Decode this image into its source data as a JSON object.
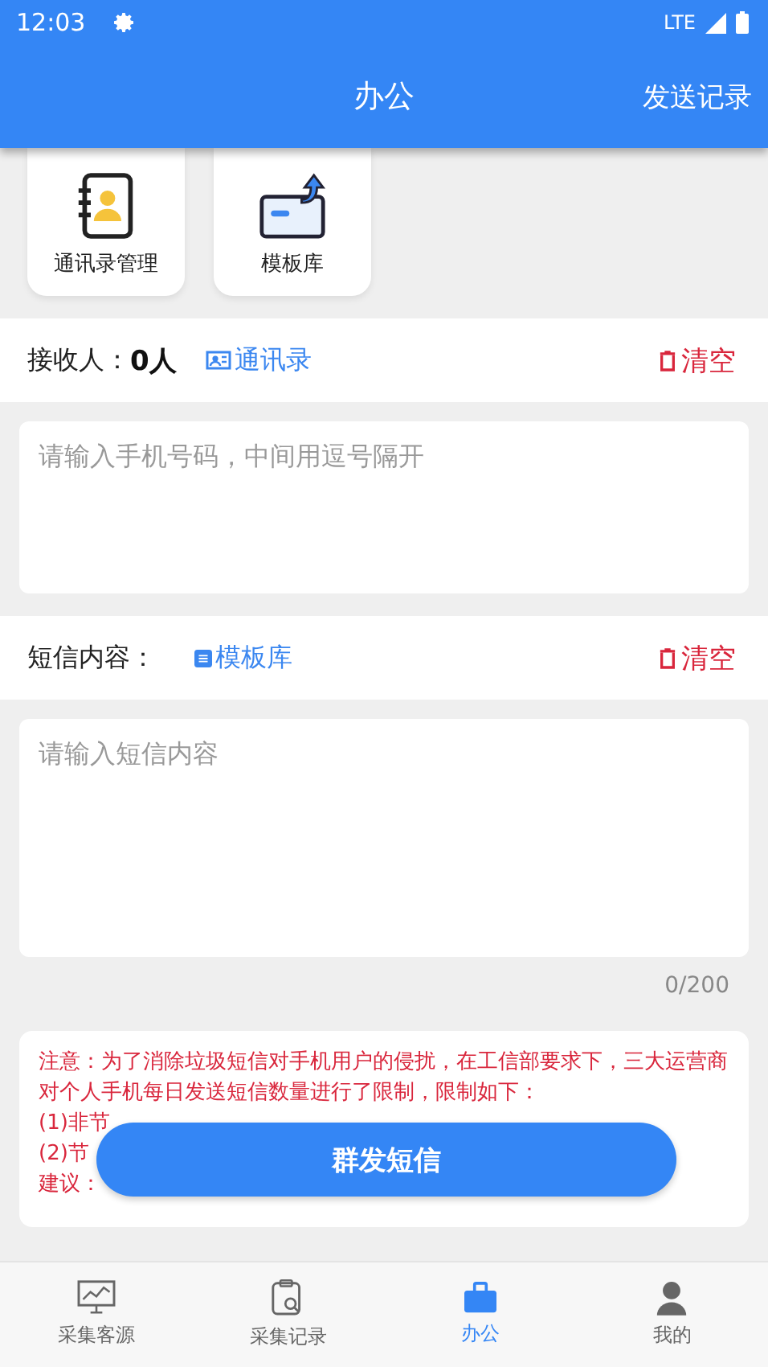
{
  "status_bar": {
    "time": "12:03",
    "network": "LTE"
  },
  "app_bar": {
    "title": "办公",
    "action": "发送记录"
  },
  "shortcuts": [
    {
      "kind": "contacts",
      "label": "通讯录管理"
    },
    {
      "kind": "template",
      "label": "模板库"
    }
  ],
  "recipients": {
    "label": "接收人：",
    "count": "0人",
    "link": "通讯录",
    "clear": "清空"
  },
  "phone_field": {
    "placeholder": "请输入手机号码，中间用逗号隔开"
  },
  "content": {
    "label": "短信内容：",
    "link": "模板库",
    "clear": "清空"
  },
  "message_field": {
    "placeholder": "请输入短信内容"
  },
  "counter": "0/200",
  "notice": [
    "注意：为了消除垃圾短信对手机用户的侵扰，在工信部要求下，三大运营商对个人手机每日发送短信数量进行了限制，限制如下：",
    "(1)非节",
    "(2)节",
    "建议："
  ],
  "send_button": "群发短信",
  "bottom_nav": [
    {
      "kind": "monitor",
      "label": "采集客源",
      "selected": false
    },
    {
      "kind": "clipboard",
      "label": "采集记录",
      "selected": false
    },
    {
      "kind": "office",
      "label": "办公",
      "selected": true
    },
    {
      "kind": "person",
      "label": "我的",
      "selected": false
    }
  ]
}
